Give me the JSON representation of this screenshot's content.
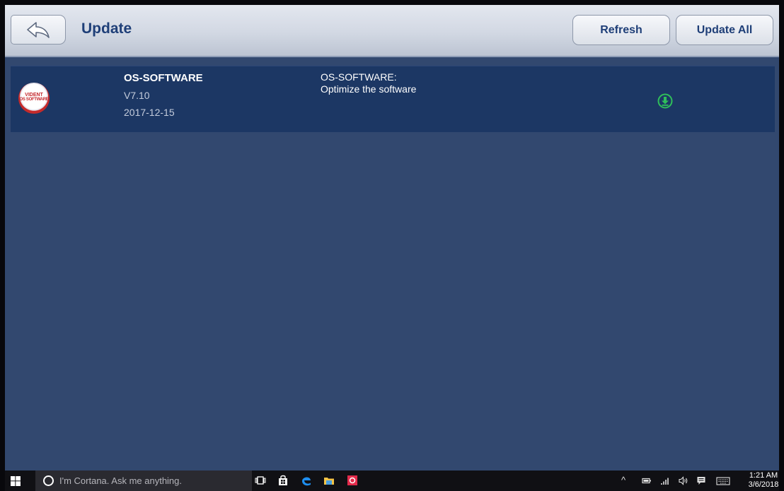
{
  "header": {
    "title": "Update",
    "refresh_label": "Refresh",
    "update_all_label": "Update All"
  },
  "updates": [
    {
      "logo_text": [
        "VIDENT",
        "OS SOFTWARE"
      ],
      "name": "OS-SOFTWARE",
      "version": "V7.10",
      "date": "2017-12-15",
      "description": [
        "OS-SOFTWARE:",
        "Optimize the software"
      ],
      "action_icon": "download-icon"
    }
  ],
  "taskbar": {
    "search_placeholder": "I'm Cortana. Ask me anything.",
    "time": "1:21 AM",
    "date": "3/6/2018",
    "tray_chevron": "^"
  },
  "colors": {
    "app_background": "#32486f",
    "row_background": "#1c3764",
    "header_text": "#1f3f78",
    "download_icon": "#2fbf5a"
  }
}
